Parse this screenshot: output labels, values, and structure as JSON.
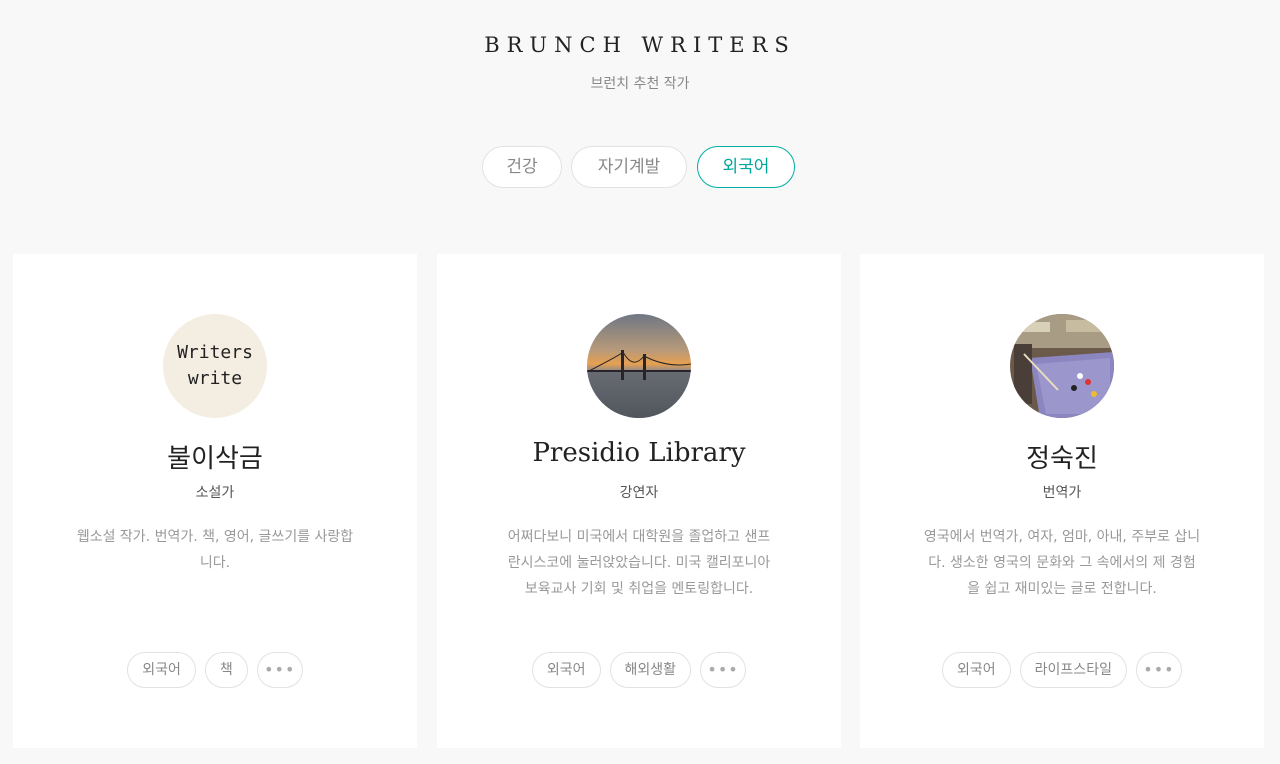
{
  "header": {
    "title": "BRUNCH WRITERS",
    "subtitle": "브런치 추천 작가"
  },
  "tabs": [
    {
      "label": "건강",
      "active": false
    },
    {
      "label": "자기계발",
      "active": false
    },
    {
      "label": "외국어",
      "active": true
    }
  ],
  "accent_color": "#00b0a0",
  "cards": [
    {
      "avatar_text_line1": "Writers",
      "avatar_text_line2": "write",
      "name": "불이삭금",
      "role": "소설가",
      "desc_line1": "웹소설 작가. 번역가. 책, 영어, 글쓰기를 사랑합",
      "desc_line2": "니다.",
      "desc_line3": "",
      "tags": [
        "외국어",
        "책"
      ],
      "more_label": "•••"
    },
    {
      "avatar_icon": "golden-gate-bridge-photo",
      "name": "Presidio Library",
      "role": "강연자",
      "desc_line1": "어쩌다보니 미국에서 대학원을 졸업하고 샌프",
      "desc_line2": "란시스코에 눌러앉았습니다. 미국 캘리포니아",
      "desc_line3": "보육교사 기회 및 취업을 멘토링합니다.",
      "tags": [
        "외국어",
        "해외생활"
      ],
      "more_label": "•••"
    },
    {
      "avatar_icon": "billiards-hall-photo",
      "name": "정숙진",
      "role": "번역가",
      "desc_line1": "영국에서 번역가, 여자, 엄마, 아내, 주부로 삽니",
      "desc_line2": "다. 생소한 영국의 문화와 그 속에서의 제 경험",
      "desc_line3": "을 쉽고 재미있는 글로 전합니다.",
      "tags": [
        "외국어",
        "라이프스타일"
      ],
      "more_label": "•••"
    }
  ]
}
